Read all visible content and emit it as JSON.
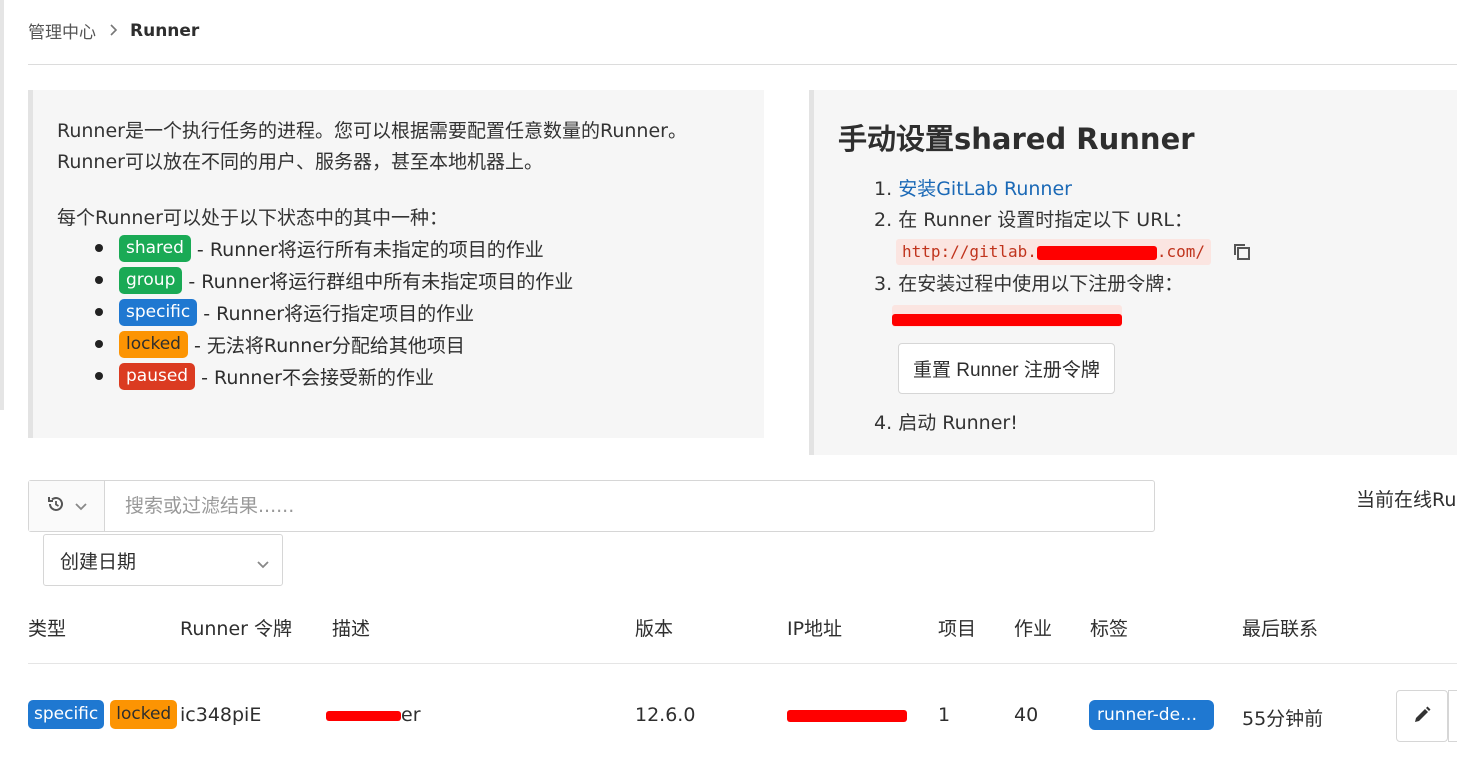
{
  "breadcrumb": {
    "parent": "管理中心",
    "current": "Runner"
  },
  "info": {
    "intro_line1": "Runner是一个执行任务的进程。您可以根据需要配置任意数量的Runner。",
    "intro_line2": "Runner可以放在不同的用户、服务器，甚至本地机器上。",
    "states_title": "每个Runner可以处于以下状态中的其中一种：",
    "states": [
      {
        "badge": "shared",
        "desc": "- Runner将运行所有未指定的项目的作业"
      },
      {
        "badge": "group",
        "desc": "- Runner将运行群组中所有未指定项目的作业"
      },
      {
        "badge": "specific",
        "desc": "- Runner将运行指定项目的作业"
      },
      {
        "badge": "locked",
        "desc": "- 无法将Runner分配给其他项目"
      },
      {
        "badge": "paused",
        "desc": "- Runner不会接受新的作业"
      }
    ]
  },
  "setup": {
    "title": "手动设置shared Runner",
    "step1_num": "1.",
    "step1_link": "安装GitLab Runner",
    "step2_num": "2.",
    "step2_text": "在 Runner 设置时指定以下 URL：",
    "url_prefix": "http://gitlab.",
    "url_suffix": ".com/",
    "step3_num": "3.",
    "step3_text": "在安装过程中使用以下注册令牌：",
    "reset_button": "重置 Runner 注册令牌",
    "step4_num": "4.",
    "step4_text": "启动 Runner!"
  },
  "filter": {
    "placeholder": "搜索或过滤结果......",
    "online_label": "当前在线Ru",
    "sort_value": "创建日期"
  },
  "table": {
    "headers": {
      "type": "类型",
      "token": "Runner 令牌",
      "description": "描述",
      "version": "版本",
      "ip": "IP地址",
      "projects": "项目",
      "jobs": "作业",
      "tags": "标签",
      "last_contact": "最后联系"
    },
    "rows": [
      {
        "type_badges": [
          "specific",
          "locked"
        ],
        "token": "ic348piE",
        "description_suffix": "er",
        "version": "12.6.0",
        "projects": "1",
        "jobs": "40",
        "tag": "runner-depl...",
        "last_contact": "55分钟前"
      }
    ]
  },
  "colors": {
    "shared": "#1aaa55",
    "group": "#1aaa55",
    "specific": "#1f78d1",
    "locked": "#fc9403",
    "paused": "#db3b21",
    "link": "#1b69b6",
    "redaction": "#ff0000"
  },
  "icons": {
    "breadcrumb_separator": "chevron-right-icon",
    "copy": "copy-icon",
    "history": "history-icon",
    "dropdown": "chevron-down-icon",
    "edit": "pencil-icon"
  }
}
